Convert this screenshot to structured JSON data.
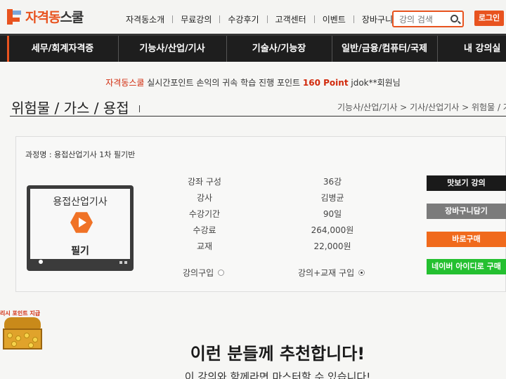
{
  "logo": {
    "part1": "자격동",
    "part2": "스쿨"
  },
  "topnav": [
    "자격동소개",
    "무료강의",
    "수강후기",
    "고객센터",
    "이벤트",
    "장바구니"
  ],
  "search": {
    "placeholder": "강의 검색"
  },
  "login_label": "로그인",
  "mainnav": [
    "세무/회계자격증",
    "기능사/산업/기사",
    "기술사/기능장",
    "일반/금융/컴퓨터/국제",
    "내 강의실"
  ],
  "notice": {
    "brand": "자격동스쿨",
    "text": " 실시간포인트 손익의 귀속 학습 진행 포인트 ",
    "points": "160 Point",
    "user": " jdok**회원님"
  },
  "page_title": "위험물 / 가스 / 용접",
  "breadcrumb": "기능사/산업/기사 > 기사/산업기사 > 위험물 / 가",
  "course": {
    "name": "과정명 : 용접산업기사 1차 필기반",
    "thumb_title": "용접산업기사",
    "thumb_sub": "필기",
    "rows": [
      {
        "label": "강좌 구성",
        "value": "36강"
      },
      {
        "label": "강사",
        "value": "김병균"
      },
      {
        "label": "수강기간",
        "value": "90일"
      },
      {
        "label": "수강료",
        "value": "264,000원"
      },
      {
        "label": "교재",
        "value": "22,000원"
      }
    ],
    "options": [
      {
        "label": "강의구입",
        "selected": false
      },
      {
        "label": "강의+교재 구입",
        "selected": true
      }
    ]
  },
  "buttons": {
    "preview": "맛보기 강의",
    "cart": "장바구니담기",
    "buy": "바로구매",
    "naver": "네이버 아이디로 구매"
  },
  "colors": {
    "accent": "#e8531f",
    "nav_bg": "#1e1e1e",
    "cart_btn": "#7b7b7b",
    "naver_btn": "#24c030",
    "buy_btn": "#f06a1c"
  },
  "promo_label": "리시 포인트 지급",
  "recommend": {
    "title": "이런 분들께 추천합니다!",
    "subtitle": "이 강의와 함께라면 마스터할 수 있습니다!"
  }
}
